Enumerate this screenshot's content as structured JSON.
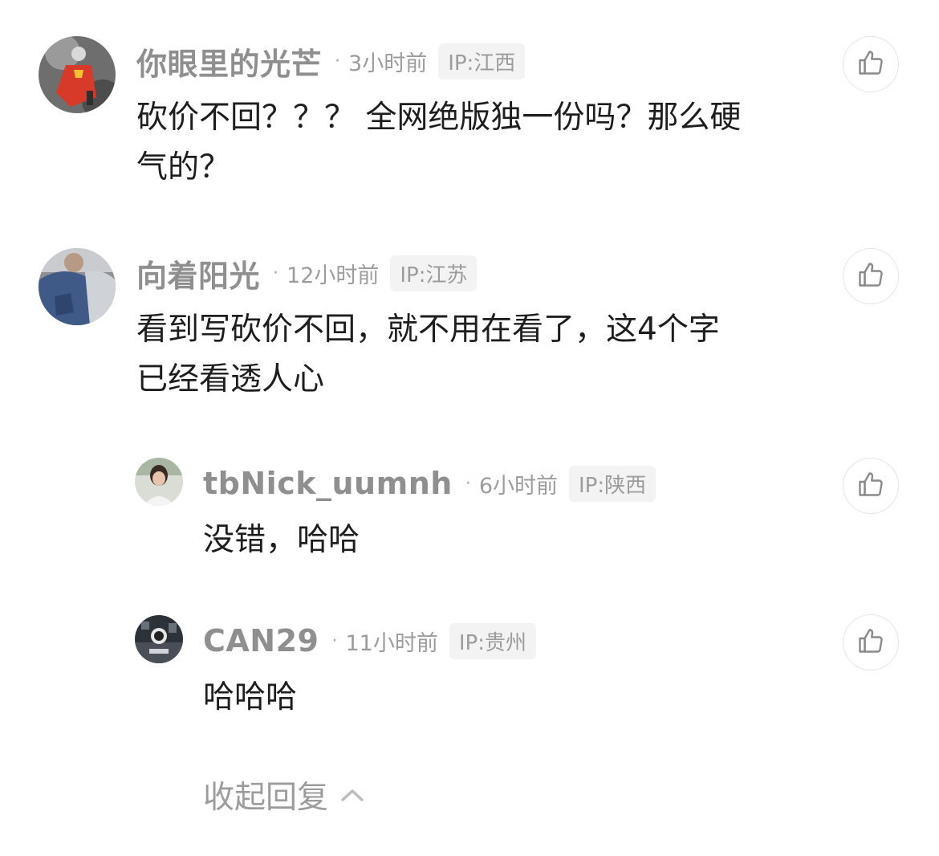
{
  "comments": [
    {
      "name": "你眼里的光芒",
      "dot": "·",
      "time": "3小时前",
      "ip": "IP:江西",
      "text_lines": [
        "砍价不回？？？ 全网绝版独一份吗？那么硬",
        "气的？"
      ]
    },
    {
      "name": "向着阳光",
      "dot": "·",
      "time": "12小时前",
      "ip": "IP:江苏",
      "text_lines": [
        "看到写砍价不回，就不用在看了，这4个字",
        "已经看透人心"
      ]
    }
  ],
  "replies": [
    {
      "name": "tbNick_uumnh",
      "dot": "·",
      "time": "6小时前",
      "ip": "IP:陕西",
      "text": "没错，哈哈"
    },
    {
      "name": "CAN29",
      "dot": "·",
      "time": "11小时前",
      "ip": "IP:贵州",
      "text": "哈哈哈"
    }
  ],
  "collapse_label": "收起回复",
  "icons": {
    "like": "thumbs-up-icon",
    "collapse": "chevron-up-icon"
  },
  "colors": {
    "name": "#8f8f8f",
    "meta": "#9c9c9c",
    "ip_badge_bg": "#f3f3f3",
    "body_text": "#1e1e1e"
  }
}
